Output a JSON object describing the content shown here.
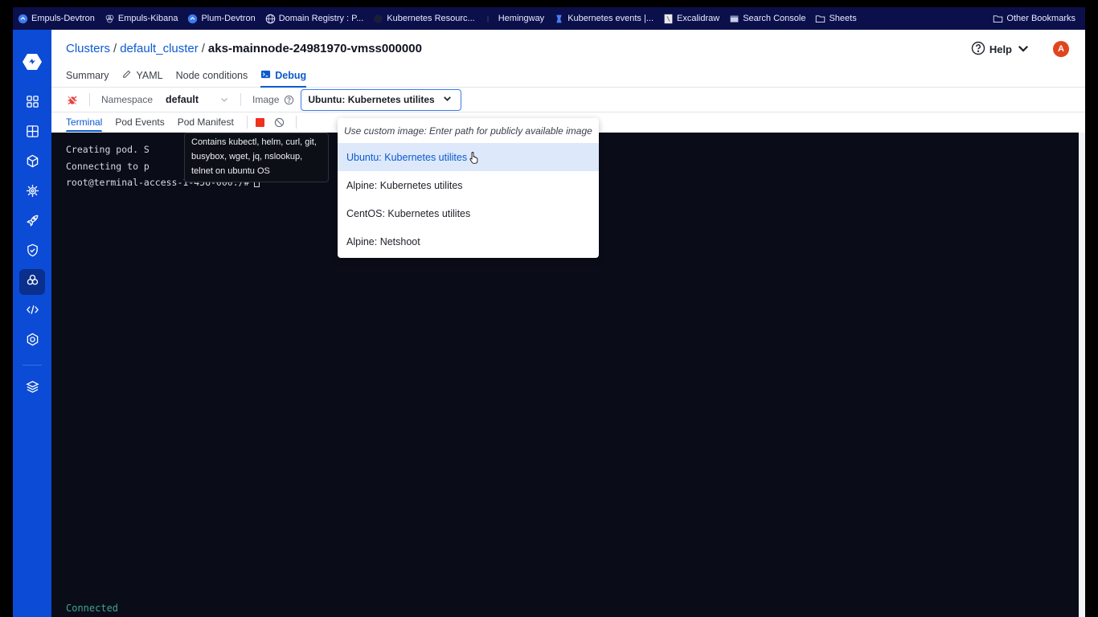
{
  "browser": {
    "bookmarks": [
      {
        "label": "Empuls-Devtron",
        "icon": "devtron-icon"
      },
      {
        "label": "Empuls-Kibana",
        "icon": "kibana-icon"
      },
      {
        "label": "Plum-Devtron",
        "icon": "devtron-icon"
      },
      {
        "label": "Domain Registry : P...",
        "icon": "globe-icon"
      },
      {
        "label": "Kubernetes Resourc...",
        "icon": "github-icon"
      },
      {
        "label": "Hemingway",
        "icon": "hemingway-icon"
      },
      {
        "label": "Kubernetes events |...",
        "icon": "kubernetes-icon"
      },
      {
        "label": "Excalidraw",
        "icon": "excalidraw-icon"
      },
      {
        "label": "Search Console",
        "icon": "search-console-icon"
      },
      {
        "label": "Sheets",
        "icon": "folder-icon"
      }
    ],
    "other_bookmarks": "Other Bookmarks"
  },
  "colors": {
    "sidebar": "#0b4bd6",
    "accent": "#0b5ad0",
    "terminal_bg": "#0a0d18",
    "connected": "#3fa293",
    "stop": "#f0311e",
    "avatar": "#e0461d"
  },
  "sidebar": {
    "items": [
      {
        "icon": "apps-grid-icon",
        "active": false
      },
      {
        "icon": "app-groups-icon",
        "active": false
      },
      {
        "icon": "cube-icon",
        "active": false
      },
      {
        "icon": "chart-store-icon",
        "active": false
      },
      {
        "icon": "rocket-icon",
        "active": false
      },
      {
        "icon": "security-shield-icon",
        "active": false
      },
      {
        "icon": "resource-browser-icon",
        "active": true
      },
      {
        "icon": "code-icon",
        "active": false
      },
      {
        "icon": "settings-gear-icon",
        "active": false
      }
    ],
    "bottom_item": {
      "icon": "layers-icon"
    }
  },
  "header": {
    "breadcrumb": {
      "items": [
        "Clusters",
        "default_cluster"
      ],
      "separator": "/",
      "current": "aks-mainnode-24981970-vmss000000"
    },
    "tabs": [
      {
        "label": "Summary",
        "active": false
      },
      {
        "label": "YAML",
        "active": false,
        "icon": "pencil-icon"
      },
      {
        "label": "Node conditions",
        "active": false
      },
      {
        "label": "Debug",
        "active": true,
        "icon": "terminal-icon"
      }
    ],
    "help_label": "Help",
    "avatar_initial": "A"
  },
  "toolbar": {
    "namespace_label": "Namespace",
    "namespace_value": "default",
    "image_label": "Image",
    "image_value": "Ubuntu: Kubernetes utilites"
  },
  "subtabs": [
    {
      "label": "Terminal",
      "active": true
    },
    {
      "label": "Pod Events",
      "active": false
    },
    {
      "label": "Pod Manifest",
      "active": false
    }
  ],
  "terminal": {
    "lines": [
      "Creating pod. S",
      "Connecting to p",
      "root@terminal-access-1-456-000:/#"
    ],
    "status": "Connected"
  },
  "tooltip": {
    "text": "Contains kubectl, helm, curl, git, busybox, wget, jq, nslookup, telnet on ubuntu OS"
  },
  "dropdown": {
    "hint": "Use custom image: Enter path for publicly available image",
    "options": [
      {
        "label": "Ubuntu: Kubernetes utilites",
        "selected": true
      },
      {
        "label": "Alpine: Kubernetes utilites",
        "selected": false
      },
      {
        "label": "CentOS: Kubernetes utilites",
        "selected": false
      },
      {
        "label": "Alpine: Netshoot",
        "selected": false
      }
    ]
  }
}
